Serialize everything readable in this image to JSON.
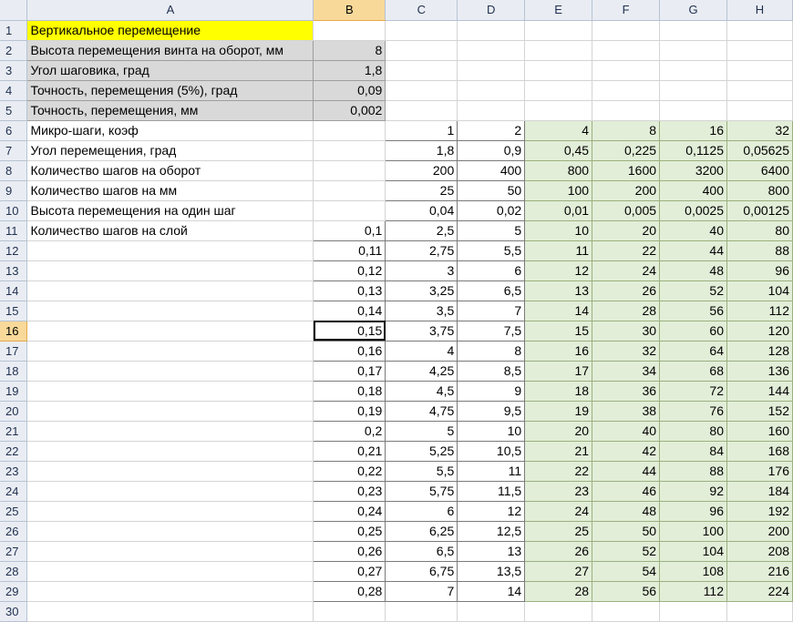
{
  "sheet": {
    "columns": [
      "A",
      "B",
      "C",
      "D",
      "E",
      "F",
      "G",
      "H"
    ],
    "active_cell": {
      "row": 16,
      "col": "B"
    },
    "rows": [
      {
        "n": "1",
        "cells": [
          "Вертикальное перемещение",
          "",
          "",
          "",
          "",
          "",
          "",
          ""
        ]
      },
      {
        "n": "2",
        "cells": [
          "Высота перемещения винта на оборот, мм",
          "8",
          "",
          "",
          "",
          "",
          "",
          ""
        ]
      },
      {
        "n": "3",
        "cells": [
          "Угол шаговика, град",
          "1,8",
          "",
          "",
          "",
          "",
          "",
          ""
        ]
      },
      {
        "n": "4",
        "cells": [
          "Точность, перемещения (5%), град",
          "0,09",
          "",
          "",
          "",
          "",
          "",
          ""
        ]
      },
      {
        "n": "5",
        "cells": [
          "Точность, перемещения, мм",
          "0,002",
          "",
          "",
          "",
          "",
          "",
          ""
        ]
      },
      {
        "n": "6",
        "cells": [
          "Микро-шаги, коэф",
          "",
          "1",
          "2",
          "4",
          "8",
          "16",
          "32"
        ]
      },
      {
        "n": "7",
        "cells": [
          "Угол перемещения, град",
          "",
          "1,8",
          "0,9",
          "0,45",
          "0,225",
          "0,1125",
          "0,05625"
        ]
      },
      {
        "n": "8",
        "cells": [
          "Количество шагов на оборот",
          "",
          "200",
          "400",
          "800",
          "1600",
          "3200",
          "6400"
        ]
      },
      {
        "n": "9",
        "cells": [
          "Количество шагов на мм",
          "",
          "25",
          "50",
          "100",
          "200",
          "400",
          "800"
        ]
      },
      {
        "n": "10",
        "cells": [
          "Высота перемещения на один шаг",
          "",
          "0,04",
          "0,02",
          "0,01",
          "0,005",
          "0,0025",
          "0,00125"
        ]
      },
      {
        "n": "11",
        "cells": [
          "Количество шагов на слой",
          "0,1",
          "2,5",
          "5",
          "10",
          "20",
          "40",
          "80"
        ]
      },
      {
        "n": "12",
        "cells": [
          "",
          "0,11",
          "2,75",
          "5,5",
          "11",
          "22",
          "44",
          "88"
        ]
      },
      {
        "n": "13",
        "cells": [
          "",
          "0,12",
          "3",
          "6",
          "12",
          "24",
          "48",
          "96"
        ]
      },
      {
        "n": "14",
        "cells": [
          "",
          "0,13",
          "3,25",
          "6,5",
          "13",
          "26",
          "52",
          "104"
        ]
      },
      {
        "n": "15",
        "cells": [
          "",
          "0,14",
          "3,5",
          "7",
          "14",
          "28",
          "56",
          "112"
        ]
      },
      {
        "n": "16",
        "cells": [
          "",
          "0,15",
          "3,75",
          "7,5",
          "15",
          "30",
          "60",
          "120"
        ]
      },
      {
        "n": "17",
        "cells": [
          "",
          "0,16",
          "4",
          "8",
          "16",
          "32",
          "64",
          "128"
        ]
      },
      {
        "n": "18",
        "cells": [
          "",
          "0,17",
          "4,25",
          "8,5",
          "17",
          "34",
          "68",
          "136"
        ]
      },
      {
        "n": "19",
        "cells": [
          "",
          "0,18",
          "4,5",
          "9",
          "18",
          "36",
          "72",
          "144"
        ]
      },
      {
        "n": "20",
        "cells": [
          "",
          "0,19",
          "4,75",
          "9,5",
          "19",
          "38",
          "76",
          "152"
        ]
      },
      {
        "n": "21",
        "cells": [
          "",
          "0,2",
          "5",
          "10",
          "20",
          "40",
          "80",
          "160"
        ]
      },
      {
        "n": "22",
        "cells": [
          "",
          "0,21",
          "5,25",
          "10,5",
          "21",
          "42",
          "84",
          "168"
        ]
      },
      {
        "n": "23",
        "cells": [
          "",
          "0,22",
          "5,5",
          "11",
          "22",
          "44",
          "88",
          "176"
        ]
      },
      {
        "n": "24",
        "cells": [
          "",
          "0,23",
          "5,75",
          "11,5",
          "23",
          "46",
          "92",
          "184"
        ]
      },
      {
        "n": "25",
        "cells": [
          "",
          "0,24",
          "6",
          "12",
          "24",
          "48",
          "96",
          "192"
        ]
      },
      {
        "n": "26",
        "cells": [
          "",
          "0,25",
          "6,25",
          "12,5",
          "25",
          "50",
          "100",
          "200"
        ]
      },
      {
        "n": "27",
        "cells": [
          "",
          "0,26",
          "6,5",
          "13",
          "26",
          "52",
          "104",
          "208"
        ]
      },
      {
        "n": "28",
        "cells": [
          "",
          "0,27",
          "6,75",
          "13,5",
          "27",
          "54",
          "108",
          "216"
        ]
      },
      {
        "n": "29",
        "cells": [
          "",
          "0,28",
          "7",
          "14",
          "28",
          "56",
          "112",
          "224"
        ]
      },
      {
        "n": "30",
        "cells": [
          "",
          "",
          "",
          "",
          "",
          "",
          "",
          ""
        ]
      }
    ]
  }
}
